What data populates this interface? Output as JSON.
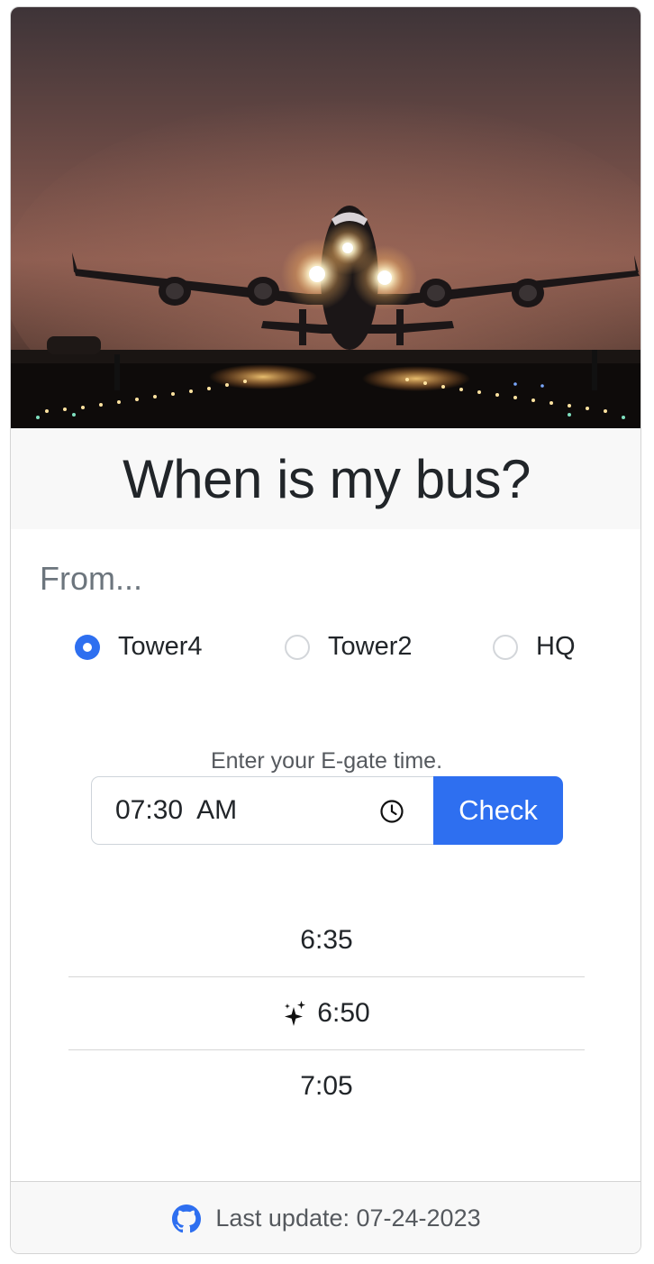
{
  "app": {
    "title": "When is my bus?"
  },
  "form": {
    "from_label": "From...",
    "locations": [
      {
        "label": "Tower4",
        "checked": true
      },
      {
        "label": "Tower2",
        "checked": false
      },
      {
        "label": "HQ",
        "checked": false
      }
    ],
    "hint": "Enter your E-gate time.",
    "time_value": "07:30  AM",
    "check_label": "Check"
  },
  "results": {
    "times": [
      "6:35",
      "6:50",
      "7:05"
    ],
    "highlighted_index": 1
  },
  "footer": {
    "last_update": "Last update: 07-24-2023"
  },
  "colors": {
    "accent": "#2e6ff0",
    "text": "#212529",
    "muted": "#6c757d",
    "surface": "#f8f8f8"
  },
  "icons": {
    "hero": "airplane-takeoff-photo",
    "time": "clock-icon",
    "highlight": "sparkle-icon",
    "footer": "github-icon"
  }
}
